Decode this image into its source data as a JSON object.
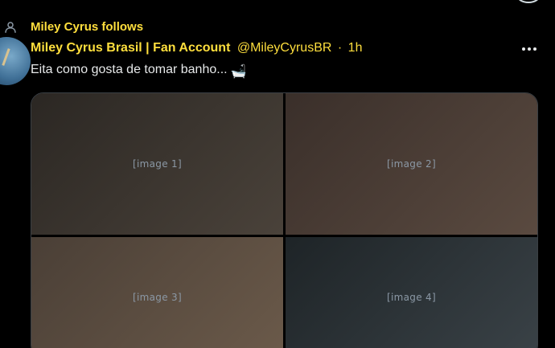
{
  "social_context": {
    "text": "Miley Cyrus follows",
    "icon": "person-follow-icon"
  },
  "tweet": {
    "display_name": "Miley Cyrus Brasil | Fan Account",
    "handle": "@MileyCyrusBR",
    "separator": "·",
    "time": "1h",
    "text": "Eita como gosta de tomar banho...",
    "emoji": "🛁",
    "more_icon": "more-horizontal-icon",
    "avatar_icon": "avatar-image"
  },
  "media": [
    {
      "label": "[image 1]"
    },
    {
      "label": "[image 2]"
    },
    {
      "label": "[image 3]"
    },
    {
      "label": "[image 4]"
    }
  ],
  "colors": {
    "background": "#000000",
    "accent": "#ffdf3d",
    "text": "#e7e9ea",
    "border": "#3a3f44"
  }
}
